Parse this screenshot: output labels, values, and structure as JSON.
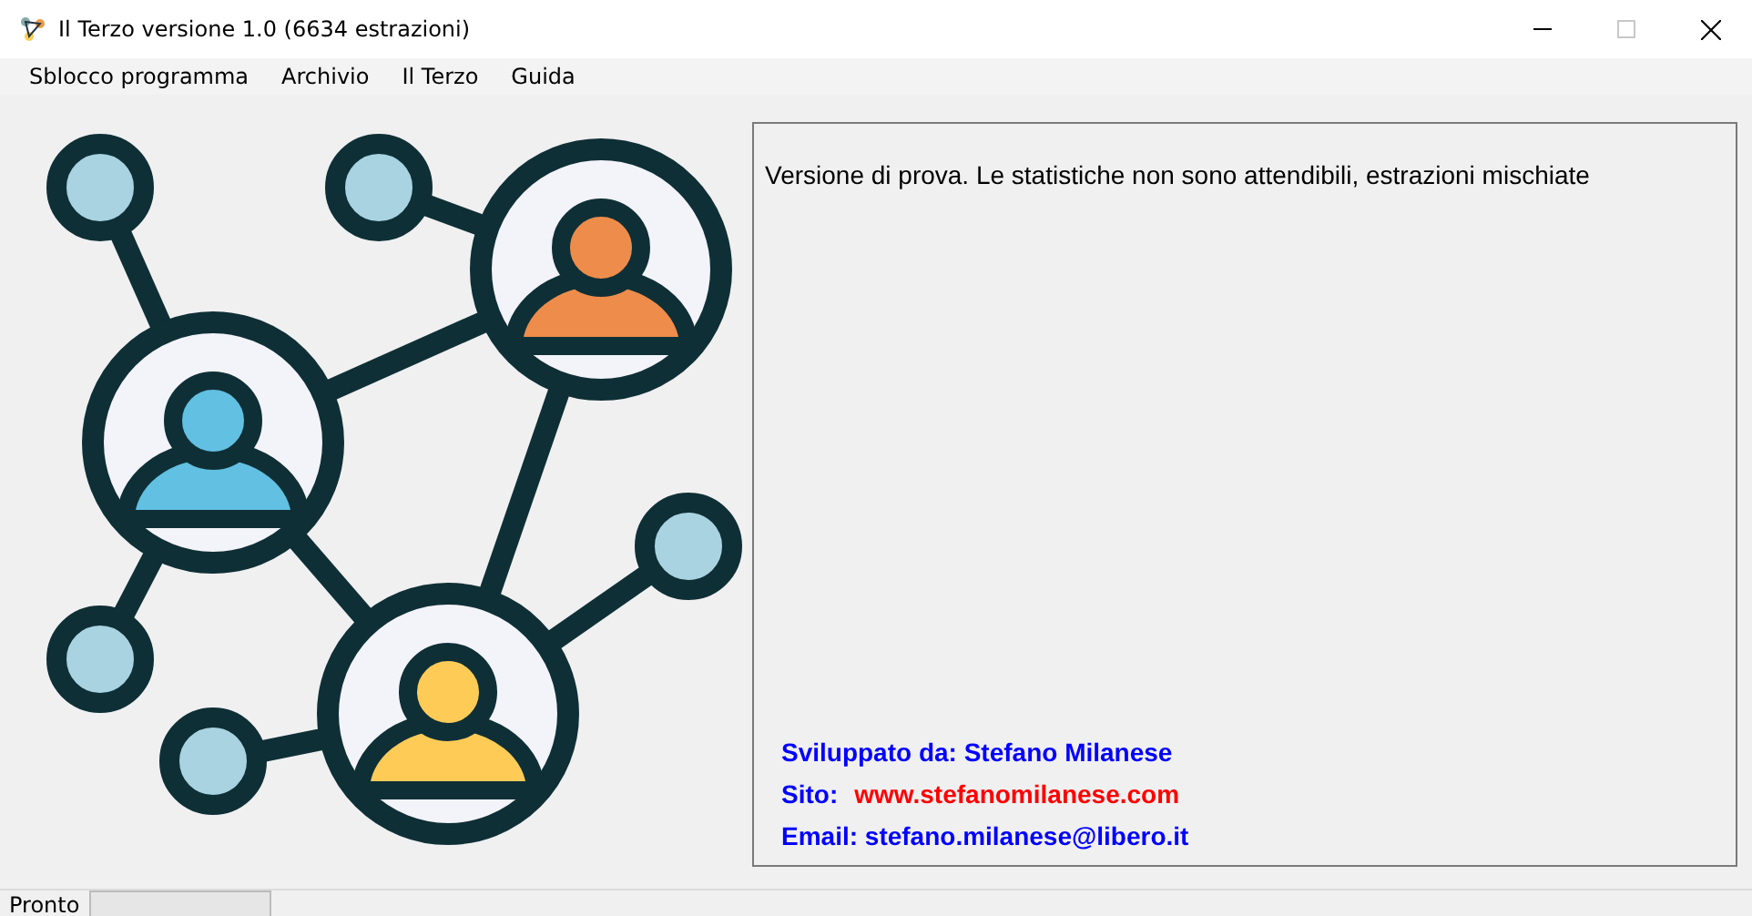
{
  "window": {
    "title": "Il Terzo versione 1.0 (6634 estrazioni)",
    "maximize_disabled": true
  },
  "menu": [
    "Sblocco programma",
    "Archivio",
    "Il Terzo",
    "Guida"
  ],
  "panel": {
    "notice": "Versione di prova. Le statistiche non sono attendibili, estrazioni mischiate",
    "developer": "Sviluppato da: Stefano Milanese",
    "site_label": "Sito:",
    "site_link": "www.stefanomilanese.com",
    "email": "Email: stefano.milanese@libero.it"
  },
  "status_bar": {
    "text": "Pronto",
    "progress": {
      "level": 0
    }
  }
}
